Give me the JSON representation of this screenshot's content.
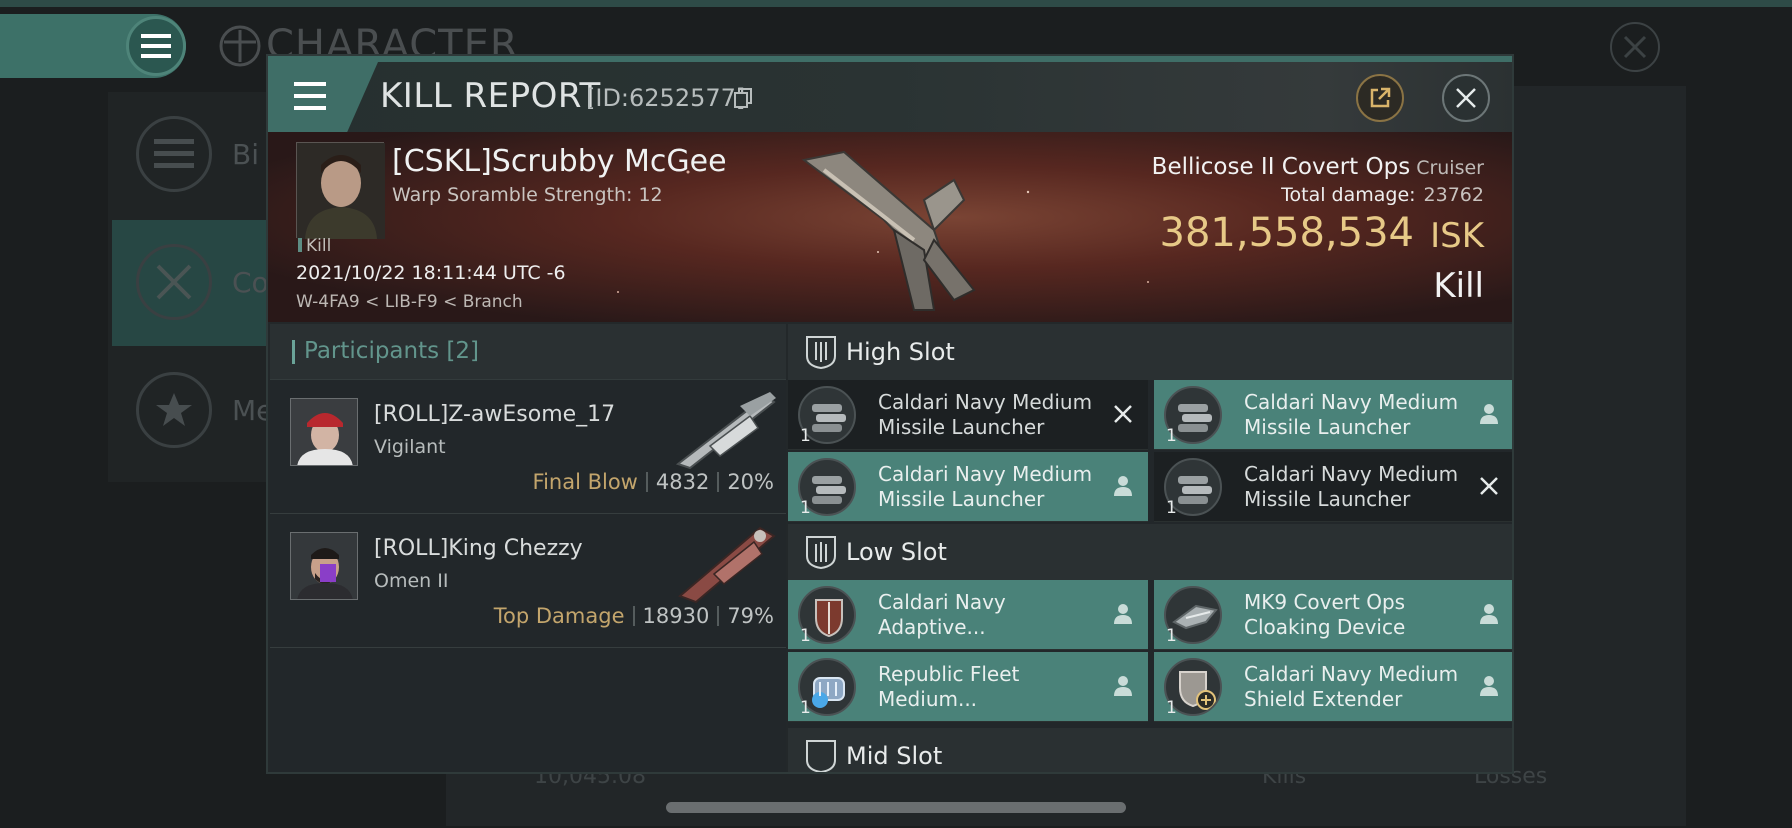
{
  "background": {
    "title": "CHARACTER",
    "sidebar": [
      {
        "label": "Bi",
        "icon": "list-icon"
      },
      {
        "label": "Co",
        "icon": "crossed-swords-icon"
      },
      {
        "label": "Me",
        "icon": "star-icon"
      }
    ],
    "bottom": {
      "value": "10,045.08",
      "kills": "Kills",
      "losses": "Losses"
    }
  },
  "modal": {
    "title": "KILL REPORT",
    "id": "[ID:6252577]",
    "victim": {
      "name": "[CSKL]Scrubby McGee",
      "warp": "Warp Soramble Strength: 12",
      "tag": "Kill",
      "time": "2021/10/22 18:11:44 UTC -6",
      "location": "W-4FA9 < LIB-F9 < Branch",
      "ship": "Bellicose II Covert Ops",
      "ship_class": "Cruiser",
      "total_damage_label": "Total damage:",
      "total_damage": "23762",
      "isk_value": "381,558,534",
      "isk_unit": "ISK",
      "result": "Kill"
    },
    "participants": {
      "header": "Participants [2]",
      "rows": [
        {
          "name": "[ROLL]Z-awEsome_17",
          "ship": "Vigilant",
          "label": "Final Blow",
          "damage": "4832",
          "percent": "20%"
        },
        {
          "name": "[ROLL]King Chezzy",
          "ship": "Omen II",
          "label": "Top Damage",
          "damage": "18930",
          "percent": "79%"
        }
      ]
    },
    "high_slot": {
      "title": "High Slot",
      "modules": [
        {
          "name": "Caldari Navy Medium Missile Launcher",
          "qty": "1",
          "status": "destroyed"
        },
        {
          "name": "Caldari Navy Medium Missile Launcher",
          "qty": "1",
          "status": "dropped"
        },
        {
          "name": "Caldari Navy Medium Missile Launcher",
          "qty": "1",
          "status": "dropped"
        },
        {
          "name": "Caldari Navy Medium Missile Launcher",
          "qty": "1",
          "status": "destroyed"
        }
      ]
    },
    "low_slot": {
      "title": "Low Slot",
      "modules": [
        {
          "name": "Caldari Navy Adaptive...",
          "qty": "1",
          "status": "dropped"
        },
        {
          "name": "MK9 Covert Ops Cloaking Device",
          "qty": "1",
          "status": "dropped"
        },
        {
          "name": "Republic Fleet Medium...",
          "qty": "1",
          "status": "dropped"
        },
        {
          "name": "Caldari Navy Medium Shield Extender",
          "qty": "1",
          "status": "dropped"
        }
      ]
    },
    "next_slot": {
      "title": "Mid Slot"
    }
  },
  "colors": {
    "accent": "#3f6e67",
    "isk": "#e7c987",
    "label": "#c3a56c",
    "dropped": "#4a8279"
  }
}
